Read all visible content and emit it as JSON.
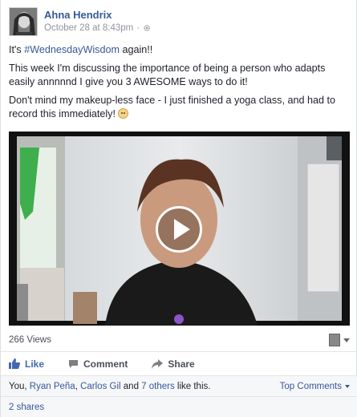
{
  "post": {
    "author": "Ahna Hendrix",
    "timestamp": "October 28 at 8:43pm",
    "separator": "·",
    "privacy_icon": "gear-icon",
    "paragraph1_prefix": "It's ",
    "hashtag": "#WednesdayWisdom",
    "paragraph1_suffix": " again!!",
    "paragraph2": "This week I'm discussing the importance of being a person who adapts easily annnnnd I give you 3 AWESOME ways to do it!",
    "paragraph3": "Don't mind my makeup-less face - I just finished a yoga class, and had to record this immediately! ",
    "emoji_icon": "smile-emoji-icon"
  },
  "video": {
    "views": "266 Views",
    "play_icon": "play-icon"
  },
  "actions": {
    "like": "Like",
    "comment": "Comment",
    "share": "Share"
  },
  "likes": {
    "prefix": "You, ",
    "person1": "Ryan Peña",
    "sep1": ", ",
    "person2": "Carlos Gil",
    "and": " and ",
    "others": "7 others",
    "suffix": " like this.",
    "top_comments": "Top Comments"
  },
  "shares": {
    "label": "2 shares"
  },
  "colors": {
    "link": "#365899",
    "like_blue": "#4267b2",
    "meta_gray": "#90949c"
  }
}
